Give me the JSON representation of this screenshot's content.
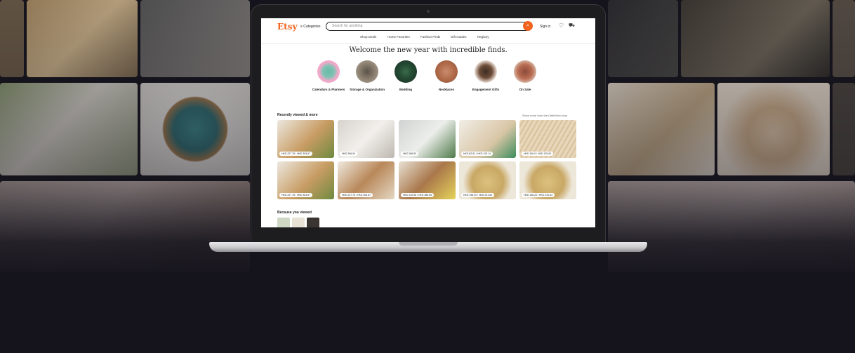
{
  "colors": {
    "accent": "#f1641e",
    "page_bg": "#15131c"
  },
  "etsy": {
    "logo": "Etsy",
    "categories_label": "≡ Categories",
    "search_placeholder": "Search for anything",
    "search_icon": "search-icon",
    "sign_in": "Sign in",
    "heart_icon": "♡",
    "cart_icon": "🛒",
    "nav": [
      "Shop Deals",
      "Home Favorites",
      "Fashion Finds",
      "Gift Guides",
      "Registry"
    ],
    "welcome": "Welcome the new year with incredible finds.",
    "categories": [
      "Calendars & Planners",
      "Storage & Organization",
      "Bedding",
      "Necklaces",
      "Engagement Gifts",
      "On Sale"
    ],
    "recently_viewed": "Recently viewed & more",
    "show_more": "Show more from the LittleEstel shop",
    "row1_prices": [
      "HKD 227.76 / HKD 303.67",
      "HKD 266.04",
      "HKD 266.53",
      "HKD 82.51 / HKD 103.14",
      "HKD 100.0 / HKD 125.00"
    ],
    "row2_prices": [
      "HKD 227.76 / HKD 303.67",
      "HKD 227.76 / HKD 303.67",
      "HKD 242.66 / HKD 285.55",
      "HKD 198.20 / HKD 231.64",
      "HKD 198.20 / HKD 231.64"
    ],
    "because_viewed": "Because you viewed"
  }
}
